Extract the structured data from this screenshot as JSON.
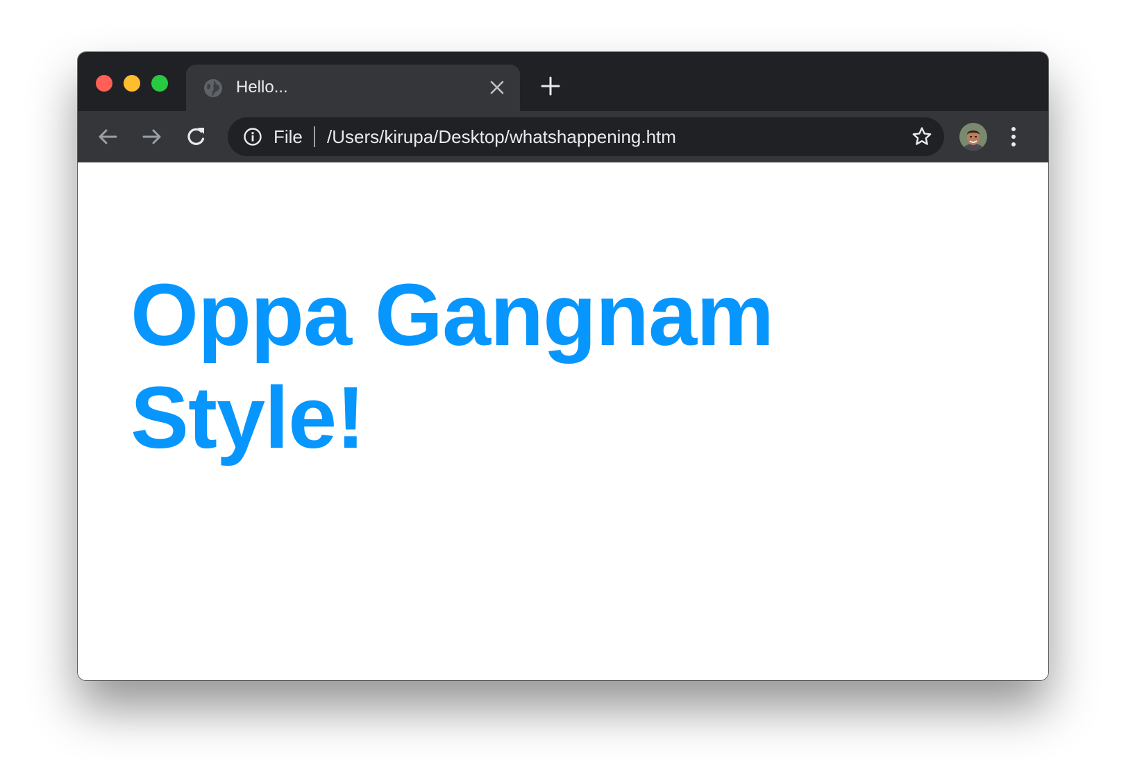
{
  "window": {
    "traffic_lights": [
      "close",
      "minimize",
      "zoom"
    ]
  },
  "tab": {
    "title": "Hello...",
    "favicon": "globe-icon",
    "close_icon": "close-icon"
  },
  "new_tab_icon": "plus-icon",
  "toolbar": {
    "back_icon": "arrow-left-icon",
    "forward_icon": "arrow-right-icon",
    "reload_icon": "reload-icon",
    "omnibox": {
      "info_icon": "info-icon",
      "scheme_label": "File",
      "url": "/Users/kirupa/Desktop/whatshappening.htm",
      "bookmark_icon": "star-icon"
    },
    "profile_icon": "avatar",
    "menu_icon": "more-vertical-icon"
  },
  "page": {
    "headline": "Oppa Gangnam Style!"
  },
  "colors": {
    "tabstrip": "#202124",
    "toolbar": "#35363a",
    "omnibox": "#202124",
    "headline": "#0796fd",
    "traffic_red": "#fe5f57",
    "traffic_yellow": "#febc2e",
    "traffic_green": "#28c840"
  }
}
